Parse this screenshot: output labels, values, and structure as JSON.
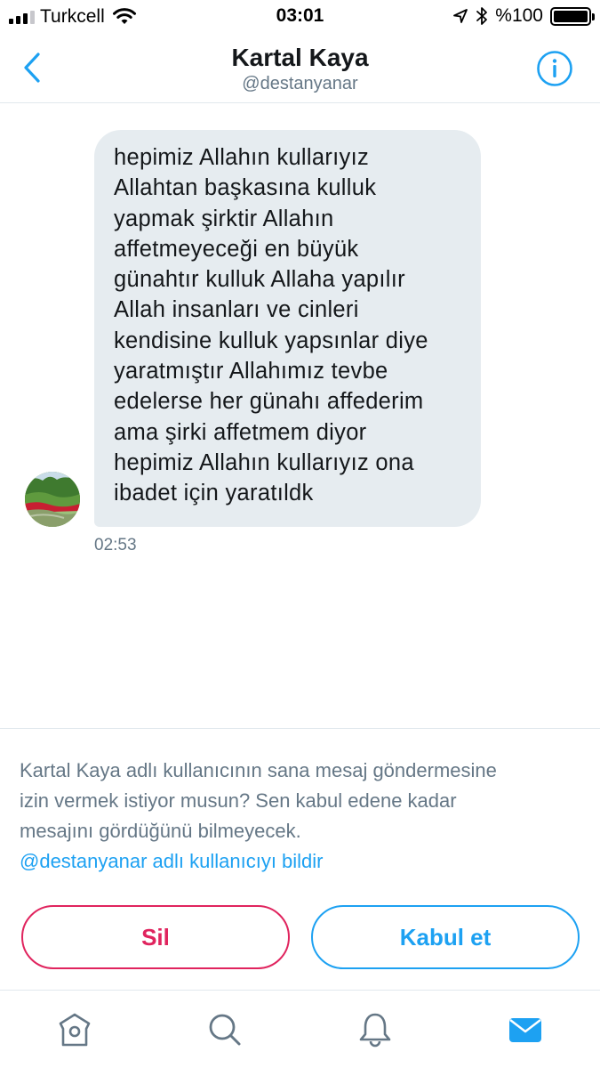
{
  "status_bar": {
    "carrier": "Turkcell",
    "time": "03:01",
    "battery": "%100",
    "battery_level": 1.0,
    "icons": [
      "signal-icon",
      "wifi-icon",
      "location-icon",
      "bluetooth-icon",
      "battery-icon"
    ]
  },
  "header": {
    "title": "Kartal Kaya",
    "handle": "@destanyanar",
    "back_icon": "chevron-left-icon",
    "info_icon": "info-icon"
  },
  "message": {
    "lines": [
      "hepimiz Allahın kullarıyız",
      "Allahtan başkasına kulluk",
      "yapmak şirktir Allahın",
      "affetmeyeceği en büyük",
      "günahtır kulluk Allaha yapılır",
      "Allah insanları ve cinleri",
      "kendisine kulluk yapsınlar diye",
      "yaratmıştır Allahımız tevbe",
      "edelerse her günahı affederim",
      "ama şirki affetmem diyor",
      "hepimiz Allahın kullarıyız ona",
      "ibadet için yaratıldk"
    ],
    "time": "02:53"
  },
  "request": {
    "lines": [
      "Kartal Kaya adlı kullanıcının sana mesaj göndermesine",
      "izin vermek istiyor musun? Sen kabul edene kadar",
      "mesajını gördüğünü bilmeyecek."
    ],
    "report_link": "@destanyanar adlı kullanıcıyı bildir",
    "delete_label": "Sil",
    "accept_label": "Kabul et"
  },
  "tab_bar": {
    "tabs": [
      "home-icon",
      "search-icon",
      "notifications-icon",
      "messages-icon"
    ],
    "active": "messages-icon"
  },
  "colors": {
    "accent": "#1da1f2",
    "delete": "#e0245e",
    "bubble": "#e6ecf0",
    "secondary_text": "#657786"
  }
}
